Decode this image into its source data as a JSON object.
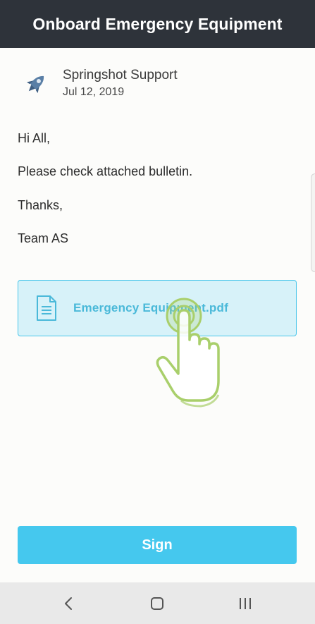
{
  "header": {
    "title": "Onboard Emergency Equipment"
  },
  "message": {
    "sender": "Springshot Support",
    "date": "Jul 12, 2019",
    "avatar_icon": "rocket-icon",
    "lines": [
      "Hi All,",
      "Please check attached bulletin.",
      "Thanks,",
      "Team AS"
    ]
  },
  "attachment": {
    "filename": "Emergency Equipment.pdf",
    "icon": "document-icon"
  },
  "overlay": {
    "icon": "tap-hand-icon"
  },
  "actions": {
    "sign_label": "Sign"
  },
  "system_nav": {
    "back": "back-icon",
    "home": "home-icon",
    "recents": "recents-icon"
  },
  "colors": {
    "topbar": "#2e333a",
    "accent": "#45c8ee",
    "attachment_bg": "#d7f2f9",
    "attachment_text": "#4ab9d9",
    "hand_stroke": "#a9cf6b"
  }
}
